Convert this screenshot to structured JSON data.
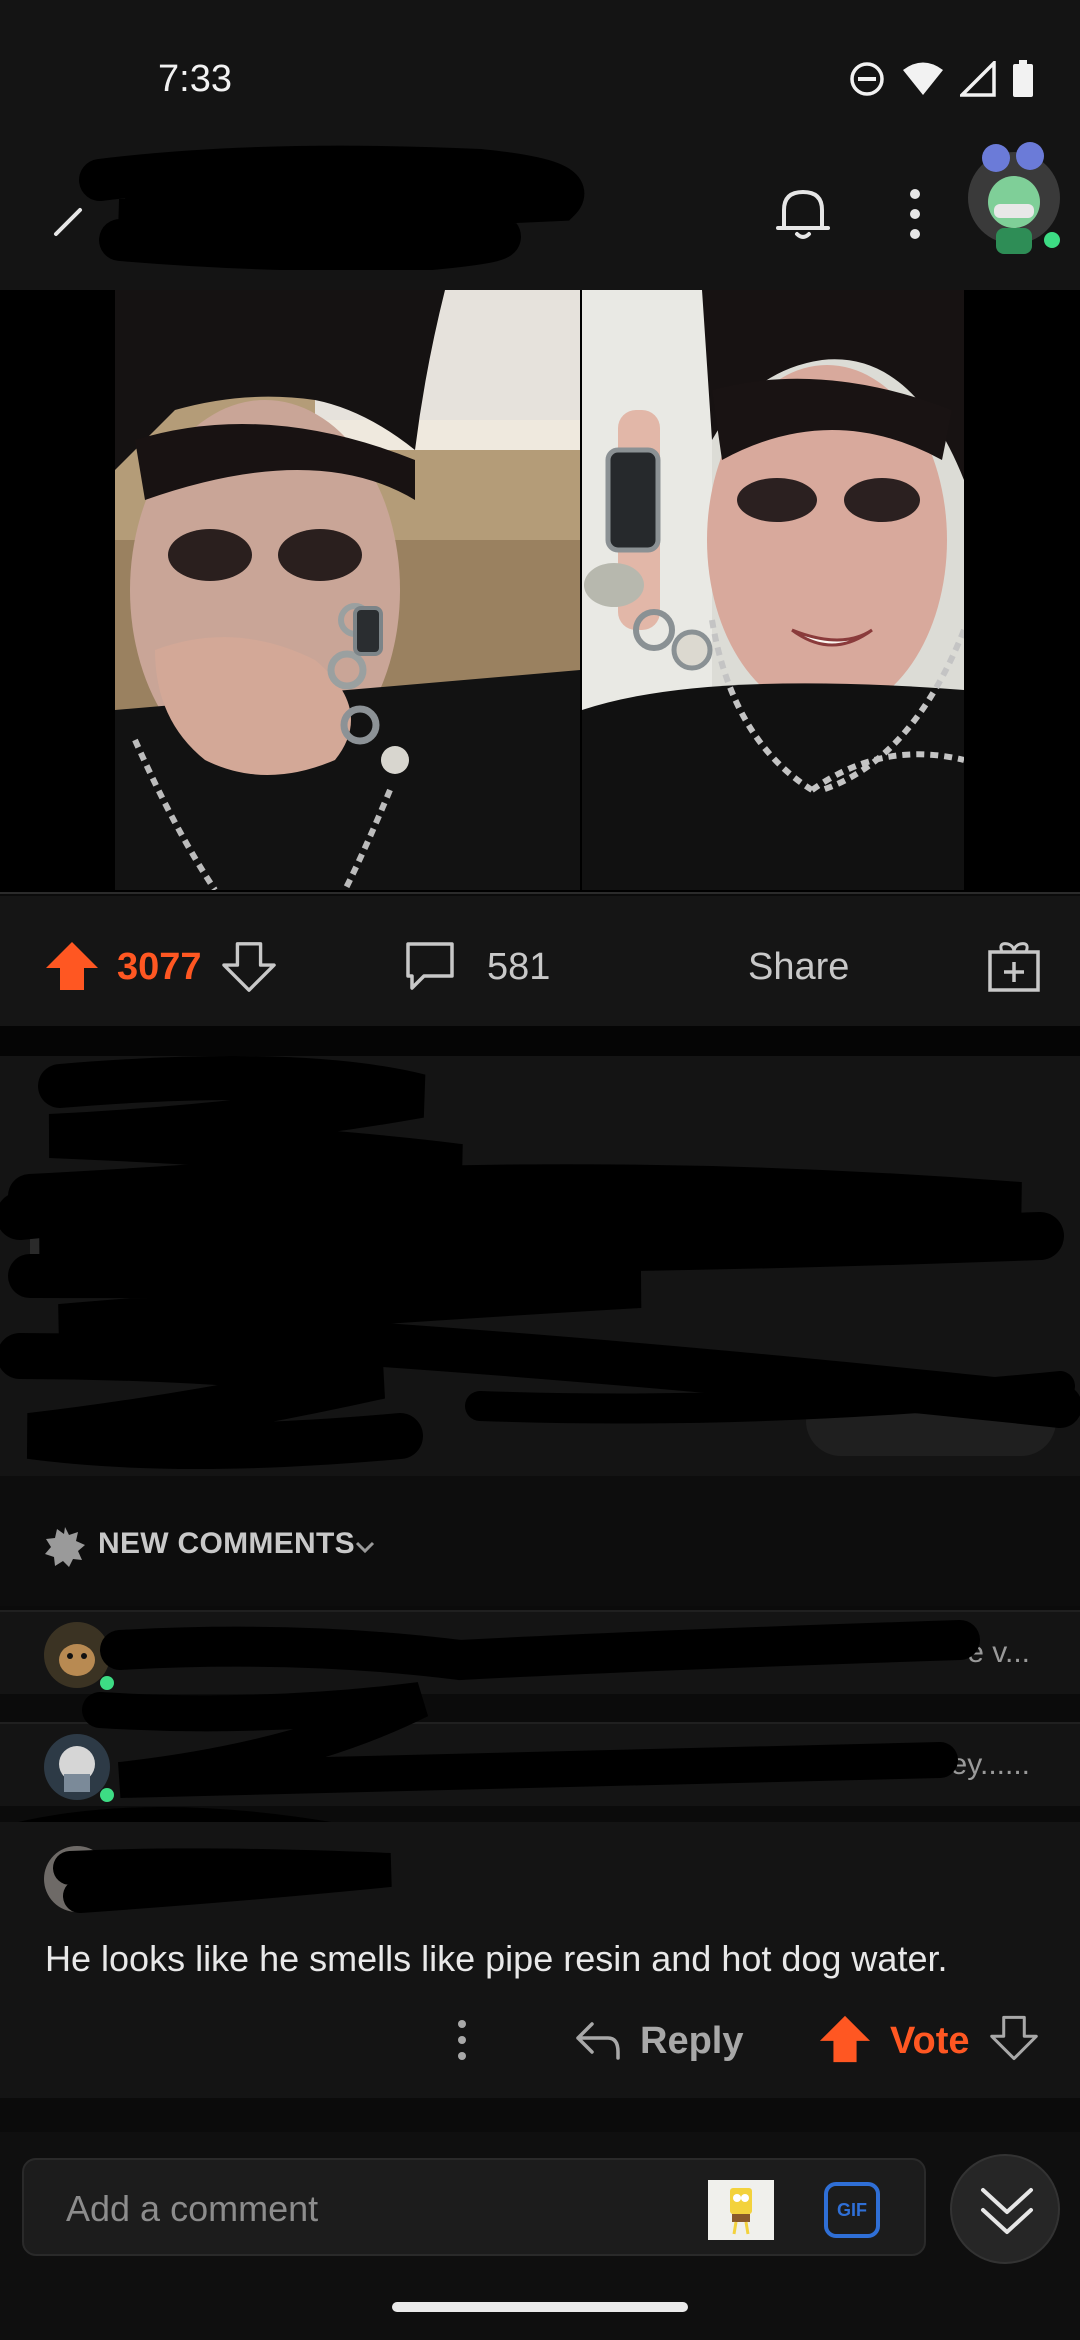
{
  "status_bar": {
    "time": "7:33"
  },
  "post": {
    "upvotes": "3077",
    "comments": "581",
    "share_label": "Share"
  },
  "sort": {
    "label": "NEW COMMENTS"
  },
  "collapsed_comments": [
    {
      "preview": "e v..."
    },
    {
      "preview": "ey......"
    }
  ],
  "comment": {
    "body": "He looks like he smells like pipe resin and hot dog water.",
    "reply_label": "Reply",
    "vote_label": "Vote"
  },
  "composer": {
    "placeholder": "Add a comment",
    "gif_label": "GIF"
  },
  "colors": {
    "accent": "#ff5722",
    "background": "#0b0b0b",
    "surface": "#141414",
    "gif_blue": "#2f6fd6"
  }
}
